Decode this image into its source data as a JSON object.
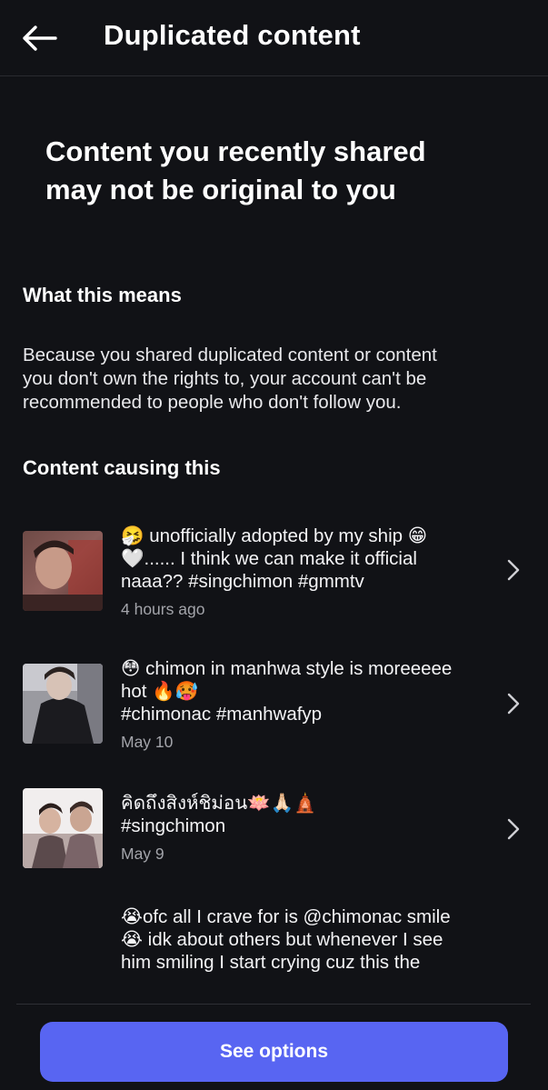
{
  "header": {
    "title": "Duplicated content",
    "back_icon": "arrow-left-icon"
  },
  "headline": {
    "line1": "Content you recently shared",
    "line2": "may not be original to you"
  },
  "what_this_means": {
    "heading": "What this means",
    "line1": "Because you shared duplicated content or content",
    "line2": "you don't own the rights to, your account can't be",
    "line3": "recommended to people who don't follow you."
  },
  "content_causing": {
    "heading": "Content causing this",
    "items": [
      {
        "line1": "🤧 unofficially adopted by my ship 😁",
        "line2": "🤍...... I think we can make it official",
        "line3": "naaa?? #singchimon #gmmtv",
        "date": "4 hours ago"
      },
      {
        "line1": "😳 chimon in manhwa style is moreeeee",
        "line2": "hot 🔥🥵",
        "line3": "#chimonac #manhwafyp",
        "date": "May 10"
      },
      {
        "line1": "คิดถึงสิงห์ชิม่อน🪷🙏🏻🛕",
        "line2": "#singchimon",
        "date": "May 9"
      },
      {
        "line1": "😭ofc all I crave for is @chimonac smile",
        "line2": "😭 idk about others but whenever I see",
        "line3": "him smiling I start crying cuz this the"
      }
    ]
  },
  "footer": {
    "button_label": "See options"
  },
  "colors": {
    "background": "#111216",
    "accent": "#5865f2",
    "secondary_text": "#a3a4aa"
  }
}
